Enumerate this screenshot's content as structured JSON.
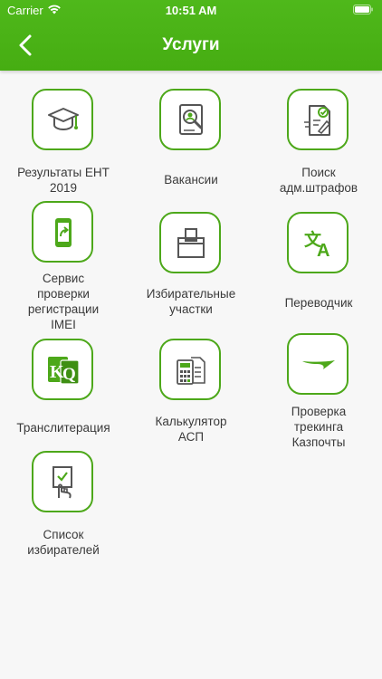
{
  "status_bar": {
    "carrier": "Carrier",
    "time": "10:51 AM"
  },
  "header": {
    "title": "Услуги"
  },
  "services": [
    {
      "label": "Результаты ЕНТ\n2019",
      "icon": "graduation-cap-icon"
    },
    {
      "label": "Вакансии",
      "icon": "resume-search-icon"
    },
    {
      "label": "Поиск\nадм.штрафов",
      "icon": "fine-document-icon"
    },
    {
      "label": "Сервис\nпроверки\nрегистрации\nIMEI",
      "icon": "phone-share-icon"
    },
    {
      "label": "Избирательные\nучастки",
      "icon": "ballot-box-icon"
    },
    {
      "label": "Переводчик",
      "icon": "translate-icon"
    },
    {
      "label": "Транслитерация",
      "icon": "kq-letters-icon"
    },
    {
      "label": "Калькулятор\nАСП",
      "icon": "calculator-icon"
    },
    {
      "label": "Проверка\nтрекинга\nКазпочты",
      "icon": "kazpost-logo-icon"
    },
    {
      "label": "Список\nизбирателей",
      "icon": "voter-list-icon"
    }
  ],
  "colors": {
    "accent": "#4da81a",
    "header": "#4fb81b",
    "text": "#3a3a3a"
  }
}
